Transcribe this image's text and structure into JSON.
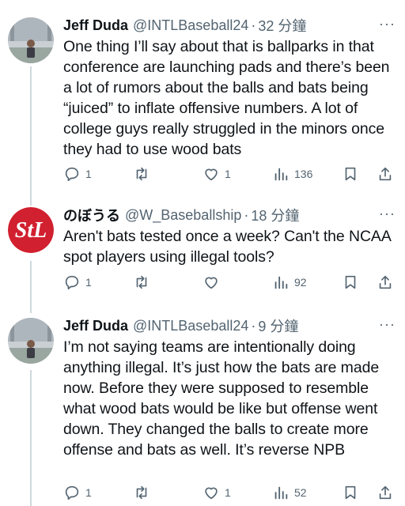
{
  "tweets": [
    {
      "name": "Jeff Duda",
      "handle": "@INTLBaseball24",
      "separator": "·",
      "time": "32 分鐘",
      "more": "···",
      "text": "One thing I’ll say about that is ballparks in that conference are launching pads and there’s been a lot of rumors about the balls and bats being “juiced” to inflate offensive numbers. A lot of college guys really struggled in the minors once they had to use wood bats",
      "replies": "1",
      "retweets": "",
      "likes": "1",
      "views": "136"
    },
    {
      "name": "のぼうる",
      "handle": "@W_Baseballship",
      "separator": "·",
      "time": "18 分鐘",
      "more": "···",
      "text": "Aren't bats tested once a week? Can't the NCAA spot players using illegal tools?",
      "replies": "1",
      "retweets": "",
      "likes": "",
      "views": "92"
    },
    {
      "name": "Jeff Duda",
      "handle": "@INTLBaseball24",
      "separator": "·",
      "time": "9 分鐘",
      "more": "···",
      "text": "I’m not saying teams are intentionally doing anything illegal. It’s just how the bats are made now. Before they were supposed to resemble what wood bats would be like but offense went down. They changed the balls to create more offense and bats as well. It’s reverse NPB",
      "replies": "1",
      "retweets": "",
      "likes": "1",
      "views": "52"
    }
  ],
  "colors": {
    "text": "#0f1419",
    "secondary": "#536471",
    "thread_line": "#cfd9de",
    "logo_red": "#d1202f"
  },
  "icons": [
    "reply-icon",
    "retweet-icon",
    "like-icon",
    "views-icon",
    "bookmark-icon",
    "share-icon",
    "more-icon"
  ]
}
